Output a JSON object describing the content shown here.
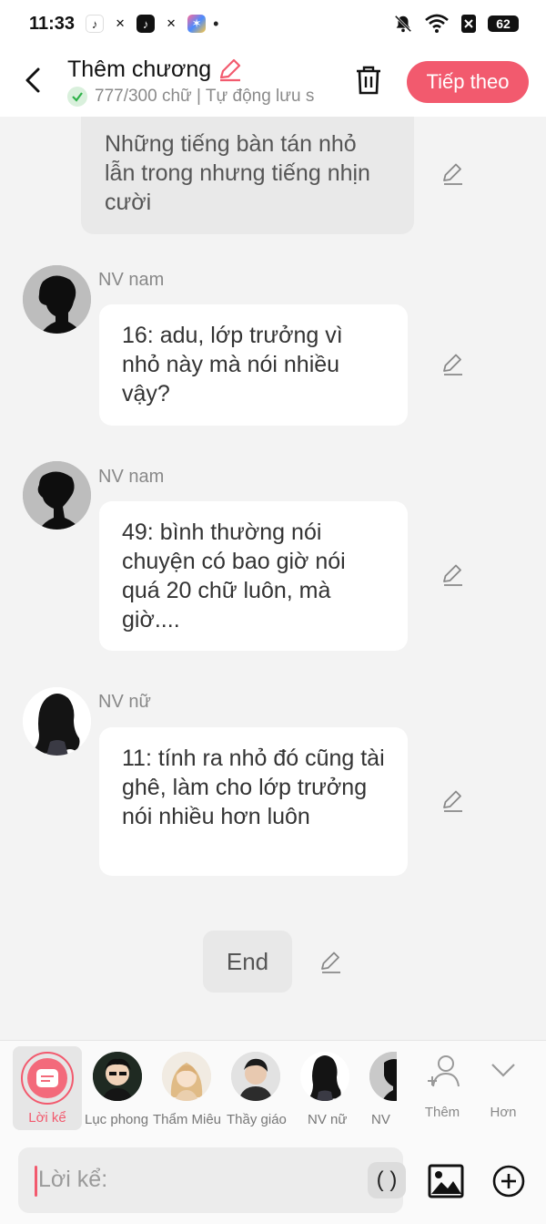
{
  "status_bar": {
    "time": "11:33",
    "battery": "62",
    "more_dot": "•"
  },
  "header": {
    "title": "Thêm chương",
    "subtitle": "777/300 chữ | Tự động lưu s",
    "next_label": "Tiếp theo"
  },
  "messages": {
    "narration_text": "Những tiếng bàn tán nhỏ lẫn trong nhưng tiếng nhịn cười",
    "items": [
      {
        "speaker": "NV nam",
        "text": "16: adu, lớp trưởng vì nhỏ này mà nói nhiều vậy?"
      },
      {
        "speaker": "NV nam",
        "text": "49: bình thường nói chuyện có bao giờ nói quá 20 chữ luôn, mà giờ...."
      },
      {
        "speaker": "NV nữ",
        "text": "11: tính ra nhỏ đó cũng tài ghê, làm cho lớp trưởng nói nhiều hơn luôn"
      }
    ],
    "end_text": "End"
  },
  "characters": {
    "narrator_label": "Lời kể",
    "items": [
      {
        "name": "Lục phong"
      },
      {
        "name": "Thẩm Miêu"
      },
      {
        "name": "Thầy giáo"
      },
      {
        "name": "NV nữ"
      },
      {
        "name": "NV"
      }
    ],
    "add_label": "Thêm",
    "more_label": "Hơn"
  },
  "input": {
    "placeholder": "Lời kể:",
    "paren_label": "( )"
  },
  "colors": {
    "accent": "#f25a6e",
    "background": "#f3f3f3"
  }
}
